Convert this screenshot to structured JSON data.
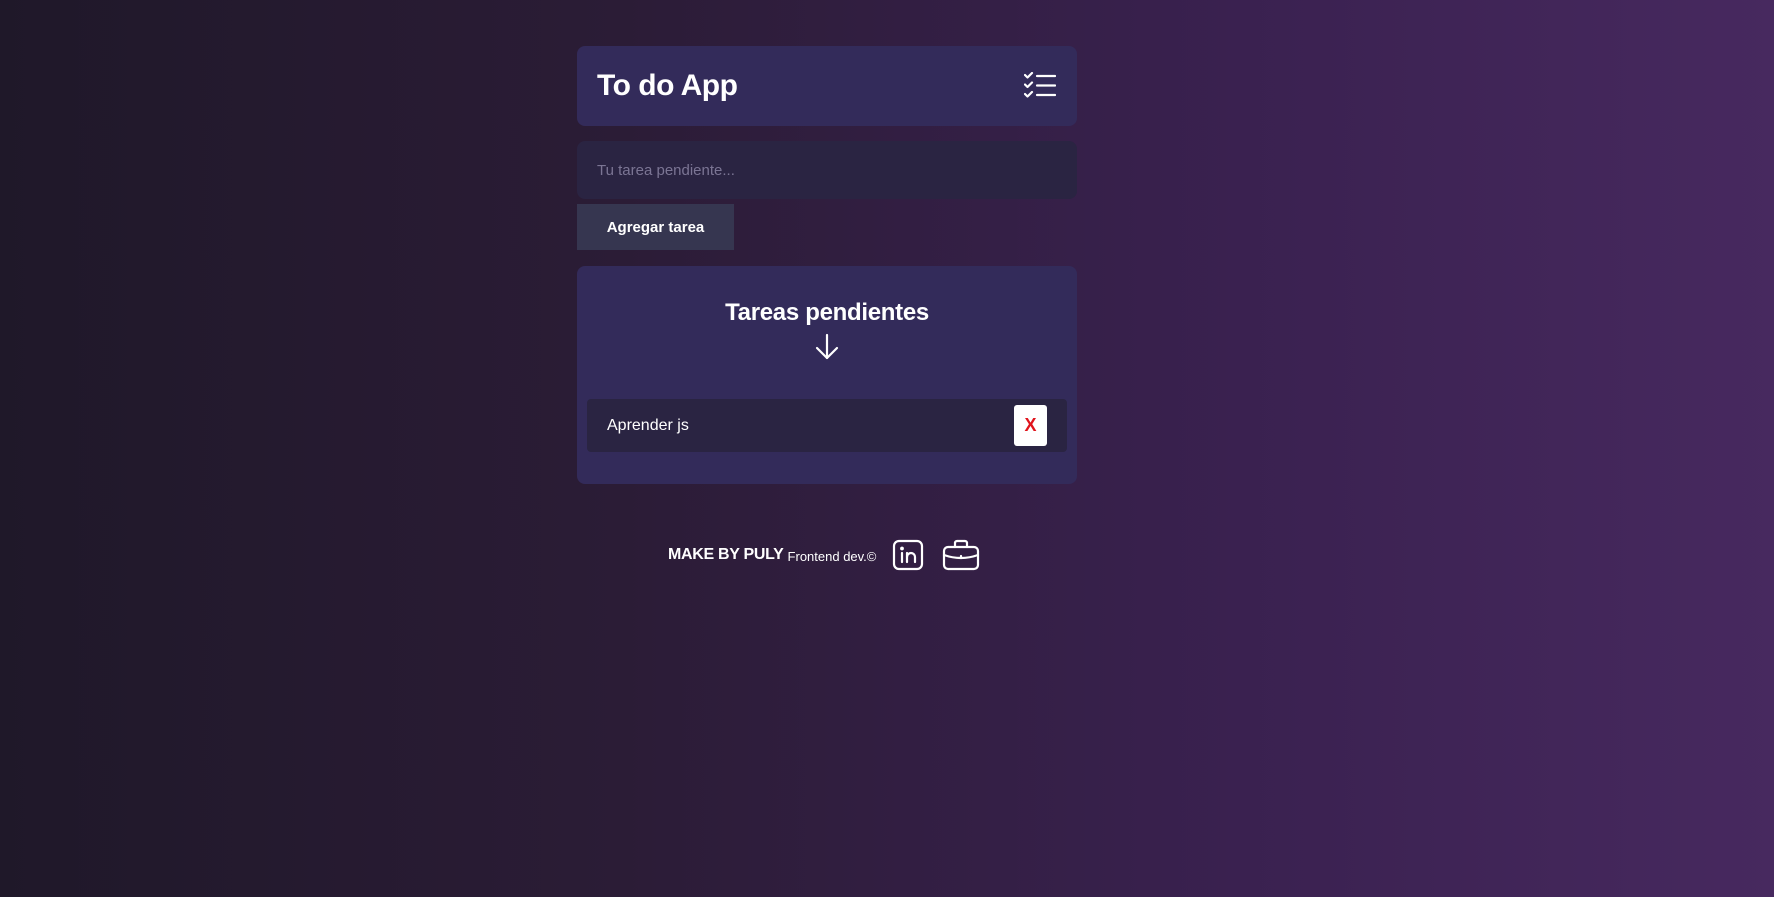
{
  "header": {
    "title": "To do App",
    "icon": "checklist-icon"
  },
  "form": {
    "placeholder": "Tu tarea pendiente...",
    "value": "",
    "add_button_label": "Agregar tarea"
  },
  "tasks": {
    "title": "Tareas pendientes",
    "arrow_icon": "arrow-down-icon",
    "items": [
      {
        "text": "Aprender js",
        "delete_label": "X"
      }
    ]
  },
  "footer": {
    "brand": "MAKE BY PULY",
    "role": "Frontend dev.©",
    "links": [
      {
        "icon": "linkedin-icon"
      },
      {
        "icon": "briefcase-icon"
      }
    ]
  },
  "colors": {
    "card": "#332b5a",
    "input": "#2a2442",
    "button": "#363650",
    "delete_text": "#e0141c"
  }
}
